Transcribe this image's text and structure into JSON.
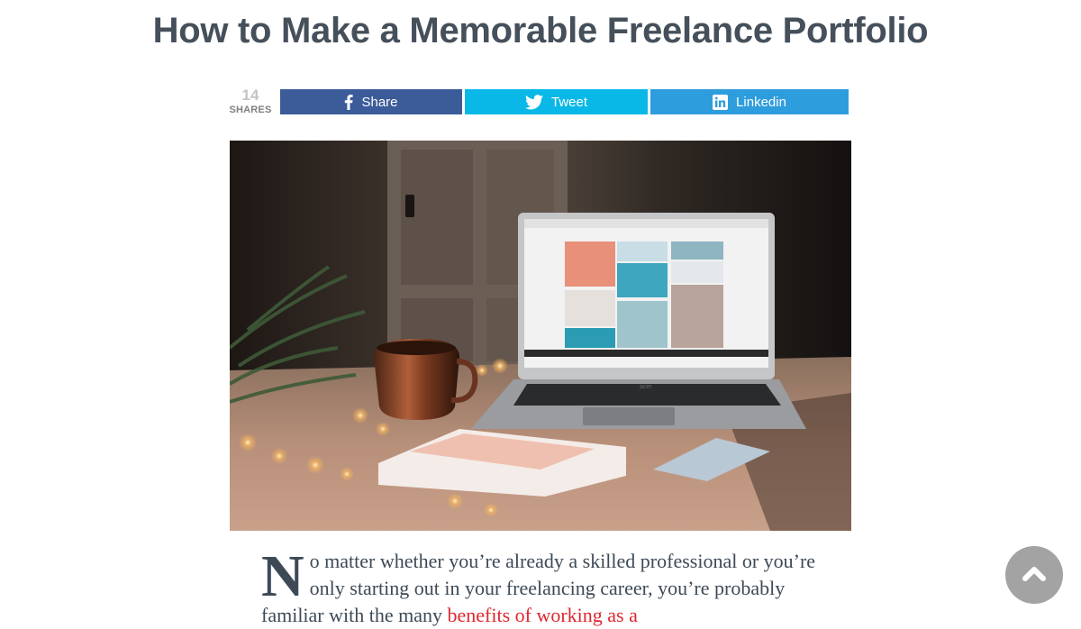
{
  "article": {
    "title": "How to Make a Memorable Freelance Portfolio",
    "dropcap": "N",
    "intro_text": "o matter whether you’re already a skilled professional or you’re only starting out in your freelancing career, you’re probably familiar with the many ",
    "intro_link": "benefits of working as a"
  },
  "share_bar": {
    "count": "14",
    "count_label": "SHARES",
    "buttons": [
      {
        "label": "Share",
        "icon": "facebook-icon",
        "color": "#3b5b99"
      },
      {
        "label": "Tweet",
        "icon": "twitter-icon",
        "color": "#0ab8e8"
      },
      {
        "label": "Linkedin",
        "icon": "linkedin-icon",
        "color": "#2e9ddd"
      }
    ]
  },
  "hero_image": {
    "laptop_brand": "acer"
  },
  "back_to_top": {
    "icon": "chevron-up-icon",
    "color": "#a3a3a3"
  },
  "colors": {
    "title": "#45505b",
    "link": "#e0262e",
    "body_text": "#3d4a56"
  }
}
